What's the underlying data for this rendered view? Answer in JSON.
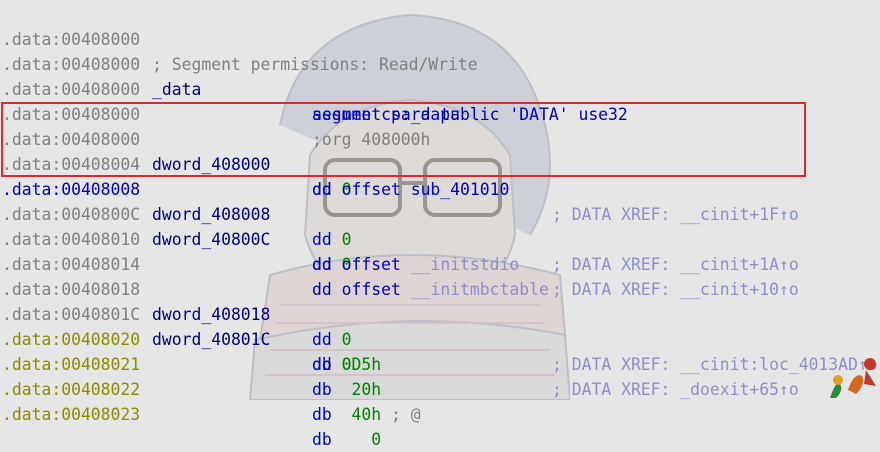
{
  "lines": [
    {
      "addr": ".data:00408000",
      "comment_left": "; Segment permissions: Read/Write"
    },
    {
      "addr": ".data:00408000",
      "label": "_data",
      "mnemonic": "segment",
      "operand": "para public 'DATA' use32"
    },
    {
      "addr": ".data:00408000",
      "mnemonic": "assume",
      "operand": "cs:_data"
    },
    {
      "addr": ".data:00408000",
      "directive": ";org 408000h"
    },
    {
      "addr": ".data:00408000",
      "label": "dword_408000",
      "mnemonic": "dd",
      "operand": "0",
      "comment": "; DATA XREF: __cinit+1F↑o"
    },
    {
      "addr": ".data:00408004",
      "mnemonic": "dd",
      "operand": "offset sub_401010"
    },
    {
      "addr": ".data:00408008",
      "label": "dword_408008",
      "mnemonic": "dd",
      "operand": "0",
      "comment": "; DATA XREF: __cinit+1A↑o"
    },
    {
      "addr": ".data:0040800C",
      "label": "dword_40800C",
      "mnemonic": "dd",
      "operand": "0",
      "comment": "; DATA XREF: __cinit+10↑o"
    },
    {
      "addr": ".data:00408010",
      "mnemonic": "dd",
      "operand_keyword": "offset",
      "operand_symbol": "__initstdio"
    },
    {
      "addr": ".data:00408014",
      "mnemonic": "dd",
      "operand_keyword": "offset",
      "operand_symbol": "__initmbctable"
    },
    {
      "addr": ".data:00408018",
      "label": "dword_408018",
      "mnemonic": "dd",
      "operand": "0",
      "comment": "; DATA XREF: __cinit:loc_4013AD↑o"
    },
    {
      "addr": ".data:0040801C",
      "label": "dword_40801C",
      "mnemonic": "dd",
      "operand": "0",
      "comment": "; DATA XREF: _doexit+65↑o"
    },
    {
      "addr": ".data:00408020",
      "mnemonic": "db",
      "operand": "0D5h"
    },
    {
      "addr": ".data:00408021",
      "mnemonic": "db",
      "operand": " 20h"
    },
    {
      "addr": ".data:00408022",
      "mnemonic": "db",
      "operand": " 40h",
      "comment_inline": " ; @"
    },
    {
      "addr": ".data:00408023",
      "mnemonic": "db",
      "operand": "   0"
    }
  ],
  "colors": {
    "background": "#e6e6e6",
    "address_gray": "#808080",
    "address_yellow": "#8c8c00",
    "address_selected": "#0000c0",
    "label": "#00007f",
    "instruction": "#0000c0",
    "number": "#008000",
    "xref_comment": "#8e8ec8",
    "highlight_box": "#e0262f"
  },
  "icons": {
    "watermark": "anime-character-watermark",
    "corner_sticker": "mascot-sticker-icon"
  }
}
